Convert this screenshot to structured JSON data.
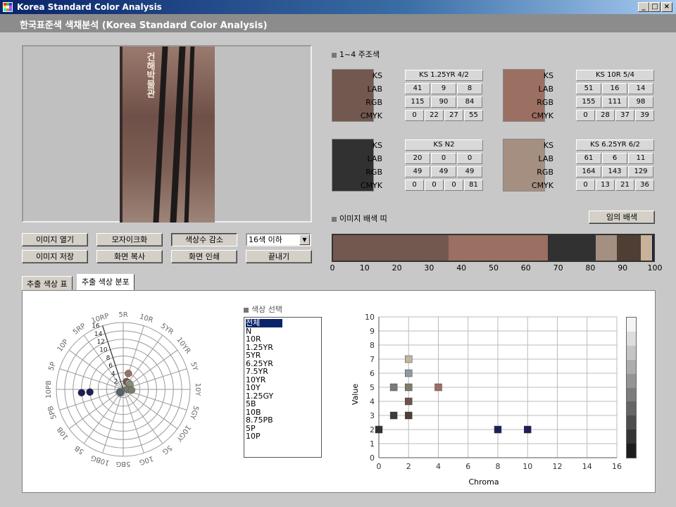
{
  "window": {
    "title": "Korea Standard Color Analysis"
  },
  "header": {
    "title": "한국표준색 색채분석 (Korea Standard Color Analysis)"
  },
  "image": {
    "sign_text": "건해박물관"
  },
  "buttons": {
    "open_image": "이미지 열기",
    "mosaic": "모자이크화",
    "reduce_colors": "색상수 감소",
    "save_image": "이미지 저장",
    "copy_screen": "화면 복사",
    "print_screen": "화면 인쇄",
    "exit": "끝내기",
    "random_layout": "임의 배색"
  },
  "colors_select": {
    "value": "16색 이하"
  },
  "main_colors": {
    "title": "1~4 주조색",
    "row_labels": [
      "KS",
      "LAB",
      "RGB",
      "CMYK"
    ],
    "items": [
      {
        "hex": "#73584f",
        "ks": "KS 1.25YR 4/2",
        "lab": [
          "41",
          "9",
          "8"
        ],
        "rgb": [
          "115",
          "90",
          "84"
        ],
        "cmyk": [
          "0",
          "22",
          "27",
          "55"
        ]
      },
      {
        "hex": "#9b6f62",
        "ks": "KS 10R 5/4",
        "lab": [
          "51",
          "16",
          "14"
        ],
        "rgb": [
          "155",
          "111",
          "98"
        ],
        "cmyk": [
          "0",
          "28",
          "37",
          "39"
        ]
      },
      {
        "hex": "#313131",
        "ks": "KS N2",
        "lab": [
          "20",
          "0",
          "0"
        ],
        "rgb": [
          "49",
          "49",
          "49"
        ],
        "cmyk": [
          "0",
          "0",
          "0",
          "81"
        ]
      },
      {
        "hex": "#a48f81",
        "ks": "KS 6.25YR 6/2",
        "lab": [
          "61",
          "6",
          "11"
        ],
        "rgb": [
          "164",
          "143",
          "129"
        ],
        "cmyk": [
          "0",
          "13",
          "21",
          "36"
        ]
      }
    ]
  },
  "color_bar": {
    "title": "이미지 배색 띠",
    "segments": [
      {
        "pct": 36,
        "hex": "#73584f"
      },
      {
        "pct": 31,
        "hex": "#9b6f62"
      },
      {
        "pct": 15,
        "hex": "#313131"
      },
      {
        "pct": 6.5,
        "hex": "#a48f81"
      },
      {
        "pct": 7.5,
        "hex": "#4f3e34"
      },
      {
        "pct": 3.5,
        "hex": "#c6b39a"
      },
      {
        "pct": 0.5,
        "hex": "#1e1e3c"
      }
    ],
    "ticks": [
      "0",
      "10",
      "20",
      "30",
      "40",
      "50",
      "60",
      "70",
      "80",
      "90",
      "100"
    ]
  },
  "tabs": [
    {
      "label": "추출 색상 표"
    },
    {
      "label": "추출 색상 분포"
    }
  ],
  "polar_chart": {
    "hue_labels": [
      "5R",
      "10R",
      "5YR",
      "10YR",
      "5Y",
      "10Y",
      "5GY",
      "10GY",
      "5G",
      "10G",
      "5BG",
      "10BG",
      "5B",
      "10B",
      "5PB",
      "10PB",
      "5P",
      "10P",
      "5RP",
      "10RP"
    ],
    "ring_labels": [
      "2",
      "4",
      "6",
      "8",
      "10",
      "12",
      "14",
      "16"
    ]
  },
  "color_select": {
    "title": "색상 선택",
    "selected": "전체",
    "items": [
      "N",
      "10R",
      "1.25YR",
      "5YR",
      "6.25YR",
      "7.5YR",
      "10YR",
      "10Y",
      "1.25GY",
      "5B",
      "10B",
      "8.75PB",
      "5P",
      "10P"
    ]
  },
  "chart_data": {
    "type": "scatter",
    "xlabel": "Chroma",
    "ylabel": "Value",
    "xlim": [
      0,
      16
    ],
    "ylim": [
      0,
      10
    ],
    "x_ticks": [
      "0",
      "2",
      "4",
      "6",
      "8",
      "10",
      "12",
      "14",
      "16"
    ],
    "y_ticks": [
      "0",
      "1",
      "2",
      "3",
      "4",
      "5",
      "6",
      "7",
      "8",
      "9",
      "10"
    ],
    "grid": true,
    "points": [
      {
        "x": 0,
        "y": 2,
        "color": "#313131"
      },
      {
        "x": 1,
        "y": 3,
        "color": "#3d3a38"
      },
      {
        "x": 1,
        "y": 5,
        "color": "#7a7a7a"
      },
      {
        "x": 2,
        "y": 7,
        "color": "#c2b49e"
      },
      {
        "x": 2,
        "y": 6,
        "color": "#8e9aa0"
      },
      {
        "x": 2,
        "y": 5,
        "color": "#7e7c6a"
      },
      {
        "x": 2,
        "y": 4,
        "color": "#6e5448"
      },
      {
        "x": 2,
        "y": 3,
        "color": "#4f3e34"
      },
      {
        "x": 4,
        "y": 5,
        "color": "#9b6f62"
      },
      {
        "x": 8,
        "y": 2,
        "color": "#1e1e5a"
      },
      {
        "x": 10,
        "y": 2,
        "color": "#1e1e5a"
      }
    ]
  }
}
